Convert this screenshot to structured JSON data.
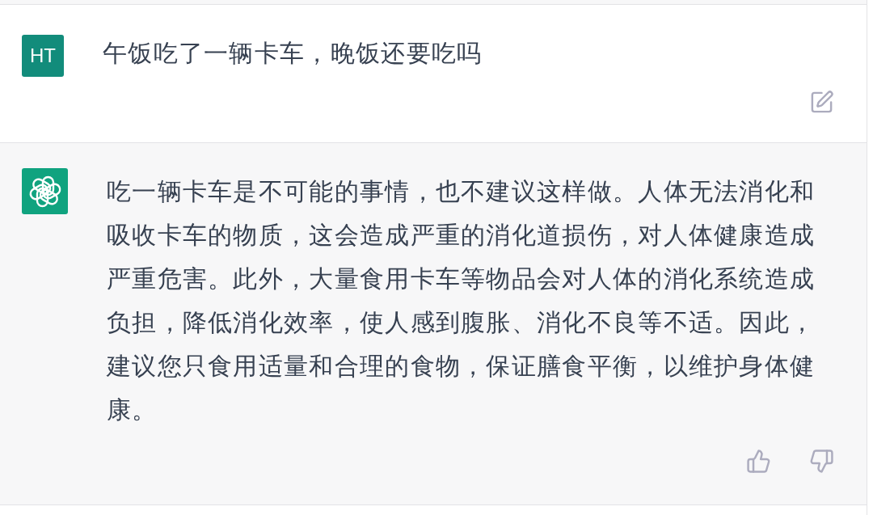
{
  "messages": [
    {
      "kind": "user",
      "avatar": {
        "initials": "HT"
      },
      "text": "午饭吃了一辆卡车，晚饭还要吃吗",
      "actions": [
        {
          "kind": "edit"
        }
      ]
    },
    {
      "kind": "assistant",
      "text": "吃一辆卡车是不可能的事情，也不建议这样做。人体无法消化和吸收卡车的物质，这会造成严重的消化道损伤，对人体健康造成严重危害。此外，大量食用卡车等物品会对人体的消化系统造成负担，降低消化效率，使人感到腹胀、消化不良等不适。因此，建议您只食用适量和合理的食物，保证膳食平衡，以维护身体健康。",
      "actions": [
        {
          "kind": "thumbs_up"
        },
        {
          "kind": "thumbs_down"
        }
      ]
    }
  ]
}
